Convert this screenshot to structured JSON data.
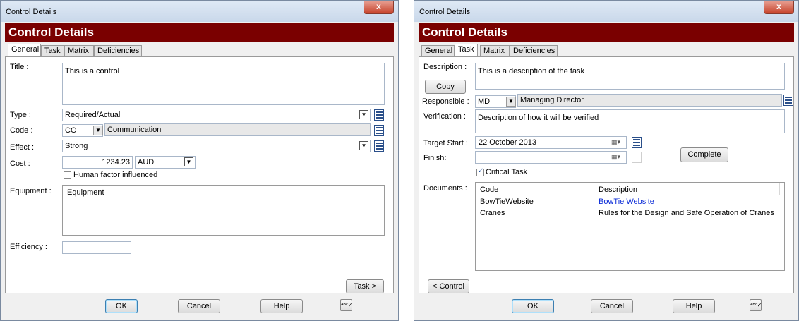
{
  "left": {
    "window_title": "Control Details",
    "close_label": "x",
    "banner": "Control Details",
    "tabs": [
      "General",
      "Task",
      "Matrix",
      "Deficiencies"
    ],
    "active_tab": "General",
    "title_label": "Title :",
    "title_value": "This is a control",
    "type_label": "Type :",
    "type_value": "Required/Actual",
    "code_label": "Code :",
    "code_value": "CO",
    "code_desc": "Communication",
    "effect_label": "Effect :",
    "effect_value": "Strong",
    "cost_label": "Cost :",
    "cost_value": "1234.23",
    "currency_value": "AUD",
    "human_factor_label": "Human factor influenced",
    "human_factor_checked": false,
    "equipment_label": "Equipment :",
    "equipment_column": "Equipment",
    "efficiency_label": "Efficiency :",
    "efficiency_value": "",
    "task_button": "Task >",
    "ok": "OK",
    "cancel": "Cancel",
    "help": "Help",
    "spell_icon": "spellcheck-icon"
  },
  "right": {
    "window_title": "Control Details",
    "close_label": "x",
    "banner": "Control Details",
    "tabs": [
      "General",
      "Task",
      "Matrix",
      "Deficiencies"
    ],
    "active_tab": "Task",
    "description_label": "Description :",
    "description_value": "This is a description of the task",
    "copy_button": "Copy",
    "responsible_label": "Responsible :",
    "responsible_code": "MD",
    "responsible_name": "Managing Director",
    "verification_label": "Verification :",
    "verification_value": "Description of how it will be verified",
    "target_start_label": "Target Start :",
    "target_start_value": "22  October  2013",
    "finish_label": "Finish:",
    "finish_value": "",
    "complete_button": "Complete",
    "critical_task_label": "Critical Task",
    "critical_task_checked": true,
    "documents_label": "Documents :",
    "documents_columns": [
      "Code",
      "Description"
    ],
    "documents_rows": [
      {
        "code": "BowTieWebsite",
        "description": "BowTie Website",
        "is_link": true
      },
      {
        "code": "Cranes",
        "description": "Rules for the Design and Safe Operation of Cranes",
        "is_link": false
      }
    ],
    "control_button": "< Control",
    "ok": "OK",
    "cancel": "Cancel",
    "help": "Help",
    "spell_icon": "spellcheck-icon"
  }
}
